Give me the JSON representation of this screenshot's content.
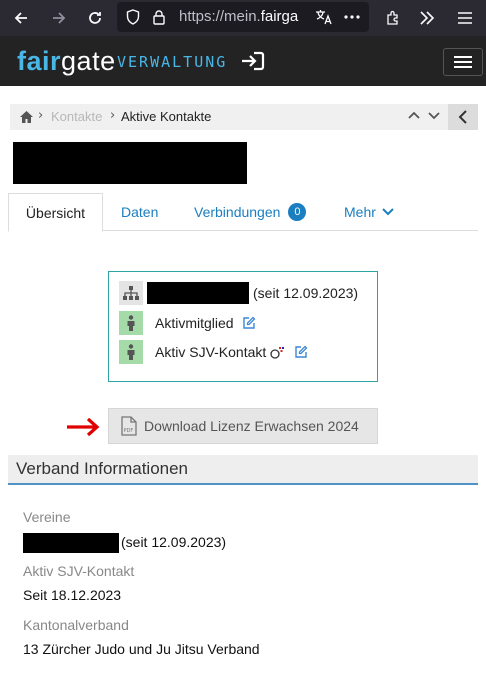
{
  "browser": {
    "url_prefix": "https://mein.",
    "url_host": "fairga",
    "icons": [
      "back-icon",
      "forward-icon",
      "reload-icon",
      "shield-icon",
      "lock-icon",
      "translate-icon",
      "more-icon",
      "extensions-icon",
      "overflow-icon",
      "menu-icon"
    ]
  },
  "app": {
    "brand_fair": "fair",
    "brand_gate": "gate",
    "brand_sub": "VERWALTUNG"
  },
  "breadcrumb": {
    "link": "Kontakte",
    "current": "Aktive Kontakte",
    "sep": "›"
  },
  "tabs": {
    "overview": "Übersicht",
    "data": "Daten",
    "connections": "Verbindungen",
    "connections_count": "0",
    "more": "Mehr"
  },
  "memberships": {
    "since": "(seit 12.09.2023)",
    "role1": "Aktivmitglied",
    "role2": "Aktiv SJV-Kontakt"
  },
  "download": {
    "label": "Download Lizenz Erwachsen 2024",
    "pdf": "PDF"
  },
  "section": {
    "title": "Verband Informationen",
    "vereine_label": "Vereine",
    "vereine_since": "(seit 12.09.2023)",
    "sjv_label": "Aktiv SJV-Kontakt",
    "sjv_value": "Seit 18.12.2023",
    "kanton_label": "Kantonalverband",
    "kanton_value": "13 Zürcher Judo und Ju Jitsu Verband"
  },
  "colors": {
    "brand_blue": "#49b6e6",
    "link_blue": "#1a7ec0",
    "teal_border": "#2fa4a4",
    "green_icon_bg": "#a5dba8",
    "arrow_red": "#e00000"
  }
}
